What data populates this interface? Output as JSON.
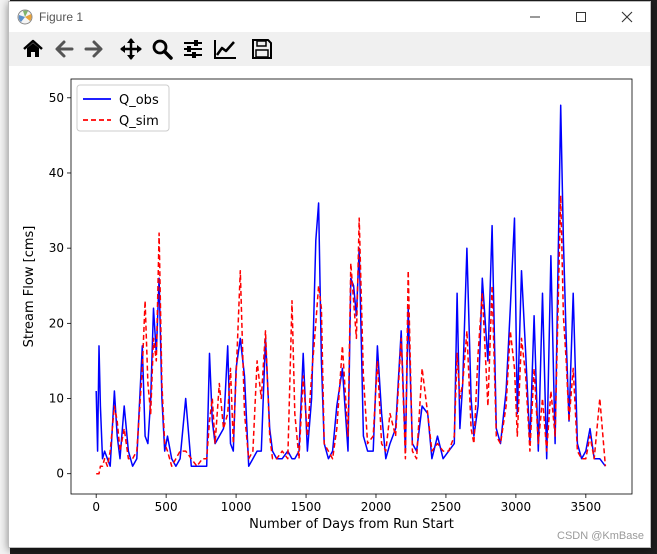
{
  "window": {
    "title": "Figure 1"
  },
  "toolbar": {
    "buttons": [
      {
        "name": "home-icon"
      },
      {
        "name": "back-arrow-icon"
      },
      {
        "name": "forward-arrow-icon"
      },
      {
        "name": "pan-icon"
      },
      {
        "name": "zoom-icon"
      },
      {
        "name": "subplots-config-icon"
      },
      {
        "name": "edit-axis-icon"
      },
      {
        "name": "save-icon"
      }
    ]
  },
  "watermark": "CSDN @KmBase",
  "colors": {
    "obs": "#0000ff",
    "sim": "#ff0000"
  },
  "chart_data": {
    "type": "line",
    "xlabel": "Number of Days from Run Start",
    "ylabel": "Stream Flow [cms]",
    "xlim": [
      -180,
      3830
    ],
    "ylim": [
      -2.7,
      52.5
    ],
    "xticks": [
      0,
      500,
      1000,
      1500,
      2000,
      2500,
      3000,
      3500
    ],
    "yticks": [
      0,
      10,
      20,
      30,
      40,
      50
    ],
    "legend": "top-left",
    "series": [
      {
        "name": "Q_obs",
        "style": "solid",
        "color": "#0000ff",
        "x": [
          0,
          10,
          20,
          30,
          45,
          60,
          80,
          100,
          130,
          150,
          170,
          200,
          230,
          260,
          290,
          330,
          350,
          370,
          390,
          410,
          430,
          450,
          470,
          490,
          510,
          540,
          570,
          600,
          640,
          680,
          720,
          760,
          790,
          810,
          830,
          850,
          880,
          910,
          940,
          960,
          980,
          1000,
          1030,
          1060,
          1090,
          1120,
          1150,
          1180,
          1210,
          1240,
          1260,
          1290,
          1330,
          1370,
          1400,
          1420,
          1450,
          1480,
          1510,
          1540,
          1570,
          1590,
          1610,
          1630,
          1660,
          1690,
          1720,
          1760,
          1800,
          1820,
          1840,
          1860,
          1880,
          1910,
          1940,
          1980,
          2010,
          2040,
          2070,
          2100,
          2140,
          2180,
          2210,
          2230,
          2260,
          2290,
          2330,
          2370,
          2400,
          2440,
          2480,
          2520,
          2560,
          2580,
          2600,
          2620,
          2650,
          2680,
          2700,
          2730,
          2760,
          2800,
          2830,
          2860,
          2890,
          2930,
          2960,
          2990,
          3010,
          3040,
          3070,
          3100,
          3130,
          3160,
          3190,
          3220,
          3250,
          3280,
          3320,
          3340,
          3360,
          3380,
          3410,
          3440,
          3470,
          3500,
          3530,
          3560,
          3600,
          3640
        ],
        "y": [
          11,
          3,
          17,
          9,
          2,
          3,
          2,
          1,
          11,
          5,
          2,
          9,
          3,
          1,
          2,
          17,
          5,
          4,
          10,
          22,
          16,
          26,
          10,
          3,
          5,
          2,
          1,
          2,
          10,
          1,
          1,
          1,
          1,
          16,
          7,
          4,
          5,
          6,
          17,
          4,
          3,
          14,
          18,
          13,
          1,
          2,
          3,
          3,
          18,
          6,
          3,
          2,
          2,
          3,
          2,
          2,
          3,
          16,
          3,
          10,
          31,
          36,
          15,
          4,
          2,
          3,
          9,
          14,
          3,
          26,
          25,
          21,
          30,
          5,
          3,
          3,
          17,
          8,
          2,
          4,
          6,
          19,
          3,
          22,
          4,
          3,
          9,
          8,
          2,
          5,
          2,
          3,
          4,
          24,
          6,
          12,
          30,
          10,
          5,
          9,
          26,
          15,
          33,
          6,
          4,
          11,
          22,
          34,
          8,
          27,
          16,
          4,
          21,
          3,
          24,
          2,
          29,
          4,
          49,
          31,
          18,
          7,
          24,
          4,
          2,
          3,
          6,
          2,
          2,
          1
        ]
      },
      {
        "name": "Q_sim",
        "style": "dashed",
        "color": "#ff0000",
        "x": [
          0,
          10,
          20,
          30,
          45,
          60,
          80,
          100,
          130,
          150,
          170,
          200,
          230,
          260,
          290,
          330,
          350,
          370,
          390,
          410,
          430,
          450,
          470,
          490,
          510,
          540,
          570,
          600,
          640,
          680,
          720,
          760,
          790,
          810,
          830,
          850,
          880,
          910,
          940,
          960,
          980,
          1000,
          1030,
          1060,
          1090,
          1120,
          1150,
          1180,
          1210,
          1240,
          1260,
          1290,
          1330,
          1370,
          1400,
          1420,
          1450,
          1480,
          1510,
          1540,
          1570,
          1590,
          1610,
          1630,
          1660,
          1690,
          1720,
          1760,
          1800,
          1820,
          1840,
          1860,
          1880,
          1910,
          1940,
          1980,
          2010,
          2040,
          2070,
          2100,
          2140,
          2180,
          2210,
          2230,
          2260,
          2290,
          2330,
          2370,
          2400,
          2440,
          2480,
          2520,
          2560,
          2580,
          2600,
          2620,
          2650,
          2680,
          2700,
          2730,
          2760,
          2800,
          2830,
          2860,
          2890,
          2930,
          2960,
          2990,
          3010,
          3040,
          3070,
          3100,
          3130,
          3160,
          3190,
          3220,
          3250,
          3280,
          3320,
          3340,
          3360,
          3380,
          3410,
          3440,
          3470,
          3500,
          3530,
          3560,
          3600,
          3640
        ],
        "y": [
          0,
          0,
          0,
          1,
          1,
          2,
          1,
          3,
          9,
          7,
          3,
          6,
          2,
          2,
          3,
          14,
          23,
          12,
          8,
          18,
          15,
          32,
          12,
          4,
          3,
          1,
          2,
          3,
          3,
          2,
          1,
          2,
          2,
          7,
          10,
          4,
          12,
          6,
          8,
          14,
          4,
          13,
          27,
          8,
          2,
          3,
          15,
          10,
          19,
          5,
          2,
          2,
          3,
          2,
          23,
          8,
          2,
          13,
          5,
          13,
          20,
          25,
          22,
          4,
          3,
          2,
          6,
          17,
          5,
          28,
          23,
          18,
          34,
          13,
          4,
          5,
          15,
          4,
          3,
          8,
          5,
          18,
          2,
          27,
          3,
          2,
          14,
          8,
          3,
          4,
          3,
          3,
          5,
          16,
          10,
          12,
          19,
          6,
          4,
          16,
          24,
          9,
          25,
          5,
          4,
          9,
          19,
          14,
          5,
          18,
          13,
          3,
          14,
          4,
          10,
          3,
          11,
          5,
          37,
          21,
          15,
          7,
          14,
          3,
          2,
          2,
          5,
          2,
          10,
          1
        ]
      }
    ]
  }
}
